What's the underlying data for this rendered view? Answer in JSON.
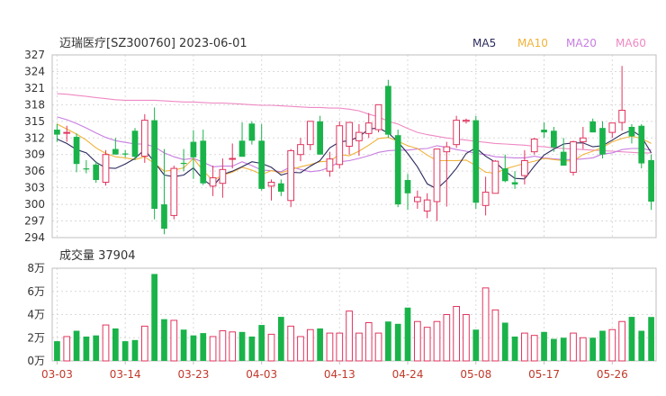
{
  "title": "迈瑞医疗[SZ300760] 2023-06-01",
  "colors": {
    "up": "#e0355f",
    "down": "#1ab34a",
    "ma5": "#2b2b5e",
    "ma10": "#f0b33a",
    "ma20": "#c77de0",
    "ma60": "#ee88c3"
  },
  "chart_data": [
    {
      "type": "candlestick",
      "title": "迈瑞医疗[SZ300760] 2023-06-01",
      "legend": [
        "MA5",
        "MA10",
        "MA20",
        "MA60"
      ],
      "legend_placement": "top-right",
      "ylim": [
        294,
        327
      ],
      "yticks": [
        "327",
        "324",
        "321",
        "318",
        "315",
        "312",
        "309",
        "306",
        "303",
        "300",
        "297",
        "294"
      ],
      "xticks": [
        {
          "label": "03-03",
          "index": 0
        },
        {
          "label": "03-14",
          "index": 7
        },
        {
          "label": "03-23",
          "index": 14
        },
        {
          "label": "04-03",
          "index": 21
        },
        {
          "label": "04-13",
          "index": 29
        },
        {
          "label": "04-24",
          "index": 36
        },
        {
          "label": "05-08",
          "index": 43
        },
        {
          "label": "05-17",
          "index": 50
        },
        {
          "label": "05-26",
          "index": 57
        }
      ],
      "grid": true,
      "ohlc": [
        [
          313.5,
          314.5,
          311.3,
          312.6
        ],
        [
          313.0,
          314.2,
          311.3,
          313.0
        ],
        [
          312.2,
          312.8,
          305.8,
          307.3
        ],
        [
          306.5,
          308.0,
          305.6,
          306.3
        ],
        [
          307.2,
          307.8,
          303.9,
          304.4
        ],
        [
          304.0,
          309.8,
          303.4,
          309.0
        ],
        [
          310.0,
          312.0,
          309.5,
          309.0
        ],
        [
          309.2,
          309.8,
          308.5,
          309.0
        ],
        [
          313.3,
          313.8,
          308.0,
          308.6
        ],
        [
          308.7,
          316.3,
          307.5,
          315.2
        ],
        [
          315.2,
          317.5,
          297.3,
          299.2
        ],
        [
          300.0,
          310.0,
          294.6,
          295.6
        ],
        [
          298.0,
          307.0,
          297.3,
          306.5
        ],
        [
          307.5,
          310.0,
          306.0,
          307.3
        ],
        [
          311.3,
          313.4,
          304.6,
          308.5
        ],
        [
          311.5,
          313.5,
          303.5,
          303.8
        ],
        [
          303.3,
          307.0,
          301.5,
          304.8
        ],
        [
          303.8,
          308.3,
          301.2,
          306.3
        ],
        [
          308.3,
          311.0,
          306.5,
          308.3
        ],
        [
          311.5,
          314.8,
          310.0,
          308.6
        ],
        [
          314.6,
          315.0,
          310.8,
          311.5
        ],
        [
          311.5,
          314.5,
          302.5,
          302.8
        ],
        [
          303.3,
          304.5,
          300.7,
          304.0
        ],
        [
          303.8,
          304.5,
          301.5,
          302.3
        ],
        [
          300.7,
          310.0,
          299.5,
          309.7
        ],
        [
          309.0,
          312.0,
          307.8,
          310.8
        ],
        [
          310.8,
          315.0,
          309.8,
          315.0
        ],
        [
          315.0,
          316.0,
          309.0,
          309.0
        ],
        [
          306.0,
          309.5,
          305.0,
          308.2
        ],
        [
          307.2,
          315.0,
          306.5,
          314.2
        ],
        [
          310.5,
          314.5,
          309.0,
          314.8
        ],
        [
          311.5,
          314.5,
          308.8,
          313.0
        ],
        [
          312.8,
          316.5,
          312.0,
          314.7
        ],
        [
          313.5,
          318.0,
          313.0,
          318.0
        ],
        [
          321.4,
          322.5,
          312.0,
          312.6
        ],
        [
          312.5,
          313.5,
          299.5,
          300.0
        ],
        [
          304.4,
          305.5,
          299.0,
          302.0
        ],
        [
          300.5,
          302.5,
          299.2,
          301.3
        ],
        [
          298.8,
          302.0,
          297.5,
          300.8
        ],
        [
          300.5,
          310.0,
          297.0,
          310.0
        ],
        [
          309.5,
          311.3,
          299.6,
          310.4
        ],
        [
          310.8,
          316.0,
          310.2,
          315.2
        ],
        [
          315.0,
          315.5,
          314.6,
          315.2
        ],
        [
          315.2,
          316.0,
          299.2,
          300.3
        ],
        [
          299.8,
          305.0,
          298.0,
          302.2
        ],
        [
          302.0,
          308.0,
          302.0,
          307.8
        ],
        [
          306.5,
          309.0,
          304.0,
          304.2
        ],
        [
          304.0,
          306.0,
          302.8,
          303.6
        ],
        [
          305.2,
          309.8,
          303.6,
          307.9
        ],
        [
          309.5,
          312.0,
          309.0,
          311.8
        ],
        [
          313.5,
          314.8,
          312.0,
          313.0
        ],
        [
          313.3,
          314.0,
          309.5,
          310.3
        ],
        [
          309.5,
          312.0,
          308.0,
          307.0
        ],
        [
          305.8,
          311.5,
          305.2,
          311.3
        ],
        [
          311.3,
          314.0,
          310.0,
          312.0
        ],
        [
          315.0,
          315.5,
          313.0,
          313.0
        ],
        [
          313.8,
          315.0,
          308.3,
          309.0
        ],
        [
          313.0,
          314.5,
          312.0,
          314.7
        ],
        [
          314.8,
          325.0,
          313.3,
          317.0
        ],
        [
          314.0,
          314.5,
          311.0,
          312.3
        ],
        [
          314.2,
          314.5,
          306.5,
          307.4
        ],
        [
          308.0,
          309.0,
          299.0,
          300.5
        ]
      ],
      "ma": {
        "MA5": [
          311.8,
          311.0,
          309.9,
          309.3,
          307.6,
          306.6,
          306.5,
          307.3,
          308.3,
          309.9,
          307.6,
          305.3,
          305.0,
          305.3,
          306.6,
          304.5,
          303.2,
          305.4,
          306.0,
          306.8,
          307.7,
          307.4,
          306.7,
          305.3,
          305.8,
          305.7,
          306.9,
          307.9,
          310.2,
          311.3,
          311.5,
          312.2,
          313.6,
          313.8,
          312.9,
          311.3,
          309.2,
          306.8,
          303.7,
          302.8,
          304.4,
          306.5,
          309.2,
          310.2,
          308.7,
          307.6,
          306.0,
          304.7,
          304.6,
          306.9,
          308.9,
          310.0,
          310.9,
          311.1,
          311.1,
          310.4,
          310.6,
          311.6,
          312.7,
          313.4,
          312.2,
          309.3
        ],
        "MA10": [
          314.5,
          313.6,
          312.7,
          311.6,
          310.2,
          309.2,
          308.6,
          308.4,
          308.1,
          308.6,
          307.4,
          306.0,
          306.2,
          306.6,
          308.3,
          306.1,
          304.3,
          305.3,
          305.8,
          306.7,
          306.2,
          305.4,
          306.1,
          305.7,
          306.3,
          306.8,
          307.2,
          307.7,
          307.8,
          309.0,
          308.8,
          309.6,
          310.7,
          311.9,
          312.1,
          311.4,
          310.6,
          310.1,
          308.9,
          307.9,
          307.9,
          307.9,
          308.0,
          307.0,
          305.8,
          305.6,
          306.4,
          306.9,
          307.4,
          307.8,
          308.3,
          308.1,
          307.9,
          307.8,
          309.0,
          309.6,
          310.3,
          311.3,
          311.9,
          312.3,
          311.9,
          311.0
        ],
        "MA20": [
          315.8,
          315.3,
          314.6,
          313.8,
          312.9,
          312.1,
          311.5,
          311.2,
          310.9,
          310.9,
          310.4,
          309.3,
          308.6,
          308.1,
          308.3,
          307.6,
          306.8,
          306.9,
          306.9,
          307.7,
          307.0,
          306.2,
          306.1,
          305.9,
          306.8,
          306.3,
          305.9,
          306.1,
          306.7,
          307.7,
          307.9,
          308.3,
          308.8,
          309.4,
          309.7,
          309.8,
          309.8,
          310.0,
          310.1,
          310.6,
          310.3,
          309.9,
          309.6,
          309.2,
          309.0,
          308.6,
          308.5,
          308.4,
          308.4,
          308.7,
          308.4,
          308.2,
          308.1,
          308.1,
          308.2,
          308.4,
          309.1,
          309.3,
          309.9,
          310.1,
          310.1,
          309.8
        ],
        "MA60": [
          320.0,
          319.9,
          319.7,
          319.5,
          319.3,
          319.1,
          318.9,
          318.8,
          318.8,
          318.8,
          318.8,
          318.7,
          318.6,
          318.5,
          318.5,
          318.4,
          318.3,
          318.3,
          318.2,
          318.1,
          318.0,
          317.9,
          317.9,
          317.8,
          317.7,
          317.6,
          317.5,
          317.5,
          317.4,
          317.4,
          317.2,
          316.9,
          316.3,
          315.8,
          315.0,
          314.5,
          313.7,
          313.0,
          312.6,
          312.3,
          312.0,
          311.8,
          311.6,
          311.4,
          311.2,
          311.0,
          310.9,
          310.8,
          310.7,
          310.5,
          310.4,
          310.2,
          310.1,
          310.0,
          309.9,
          309.8,
          309.7,
          309.6,
          309.5,
          309.4,
          309.3,
          309.3
        ]
      }
    },
    {
      "type": "bar",
      "title": "成交量 37904",
      "unit": "万",
      "ylim": [
        0,
        80000
      ],
      "yticks": [
        "8万",
        "6万",
        "4万",
        "2万",
        "0万"
      ],
      "volumes": [
        17000,
        21000,
        26000,
        21000,
        22000,
        31000,
        28000,
        17000,
        18000,
        30000,
        75000,
        36000,
        35000,
        27000,
        22000,
        24000,
        21000,
        26000,
        25000,
        25000,
        21000,
        31000,
        23000,
        38000,
        30000,
        21000,
        27000,
        28000,
        24000,
        24000,
        43000,
        24000,
        33000,
        24000,
        34000,
        32000,
        46000,
        34000,
        29000,
        34000,
        40000,
        47000,
        40000,
        27000,
        63000,
        44000,
        33000,
        21000,
        24000,
        22000,
        25000,
        19000,
        20000,
        24000,
        20000,
        20000,
        26000,
        27000,
        34000,
        38000,
        26000,
        37904
      ]
    }
  ]
}
